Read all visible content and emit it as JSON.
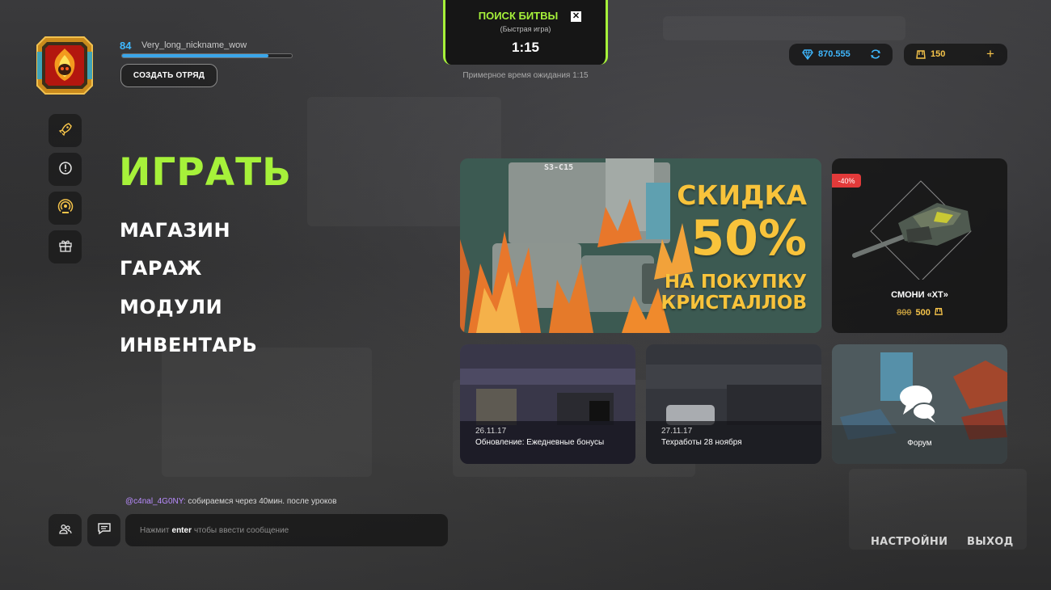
{
  "player": {
    "level": "84",
    "nickname": "Very_long_nickname_wow",
    "xp_progress": 0.86,
    "create_squad_label": "СОЗДАТЬ ОТРЯД"
  },
  "side_menu": {
    "icons": [
      "rocket-icon",
      "alert-icon",
      "signal-icon",
      "gift-icon"
    ]
  },
  "main_menu": {
    "play": "ИГРАТЬ",
    "shop": "МАГАЗИН",
    "garage": "ГАРАЖ",
    "modules": "МОДУЛИ",
    "inventory": "ИНВЕНТАРЬ"
  },
  "battle_search": {
    "title": "ПОИСК БИТВЫ",
    "close_symbol": "✕",
    "mode": "(Быстрая игра)",
    "timer": "1:15",
    "wait_text": "Примерное время ожидания 1:15"
  },
  "currency": {
    "crystals": "870.555",
    "gold": "150",
    "add_symbol": "+"
  },
  "banner": {
    "tag": "S3-C15",
    "line1": "СКИДКА",
    "line2": "50%",
    "line3": "НА ПОКУПКУ",
    "line4": "КРИСТАЛЛОВ"
  },
  "offer": {
    "badge": "-40%",
    "name": "СМОНИ «XT»",
    "old_price": "800",
    "new_price": "500"
  },
  "news": [
    {
      "date": "26.11.17",
      "title": "Обновление: Ежедневные бонусы"
    },
    {
      "date": "27.11.17",
      "title": "Техработы 28 ноября"
    }
  ],
  "forum": {
    "label": "Форум"
  },
  "chat": {
    "last_user": "@c4nal_4G0NY:",
    "last_message": " собираемся через 40мин. после уроков",
    "input_prefix": "Нажмит",
    "input_key": "enter",
    "input_suffix": "чтобы ввести сообщение"
  },
  "footer": {
    "settings": "НАСТРОЙНИ",
    "exit": "ВЫХОД"
  },
  "colors": {
    "accent": "#a6f13a",
    "crystal": "#3fb8ff",
    "gold": "#f6c44a",
    "badge": "#e23a3a"
  }
}
